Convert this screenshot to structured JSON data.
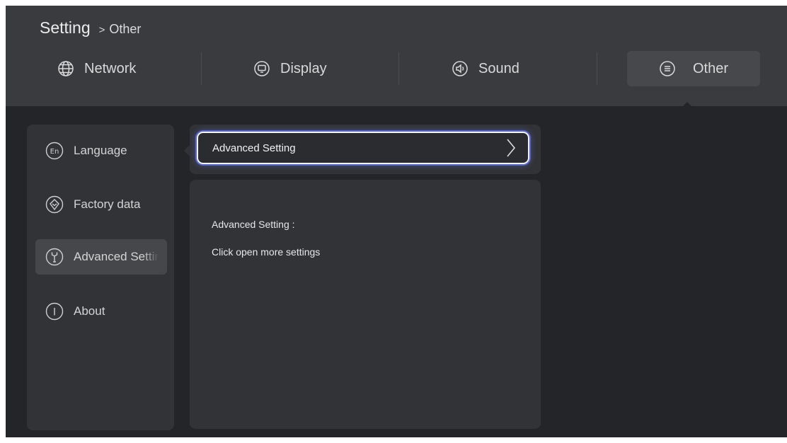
{
  "breadcrumb": {
    "root": "Setting",
    "separator": ">",
    "current": "Other"
  },
  "tabs": [
    {
      "label": "Network",
      "icon": "globe-icon",
      "active": false
    },
    {
      "label": "Display",
      "icon": "monitor-icon",
      "active": false
    },
    {
      "label": "Sound",
      "icon": "speaker-icon",
      "active": false
    },
    {
      "label": "Other",
      "icon": "menu-icon",
      "active": true
    }
  ],
  "sidebar": {
    "items": [
      {
        "label": "Language",
        "icon": "language-en-icon",
        "selected": false
      },
      {
        "label": "Factory data",
        "icon": "factory-reset-icon",
        "selected": false
      },
      {
        "label": "Advanced Setting",
        "icon": "wrench-icon",
        "selected": true
      },
      {
        "label": "About",
        "icon": "info-icon",
        "selected": false
      }
    ]
  },
  "main": {
    "option_label": "Advanced Setting",
    "description_title": "Advanced Setting :",
    "description_text": "Click open more settings"
  },
  "colors": {
    "background": "#242528",
    "header": "#3a3b3f",
    "panel": "#323337",
    "selected": "#46474b",
    "focus_glow": "#5a67c9"
  }
}
